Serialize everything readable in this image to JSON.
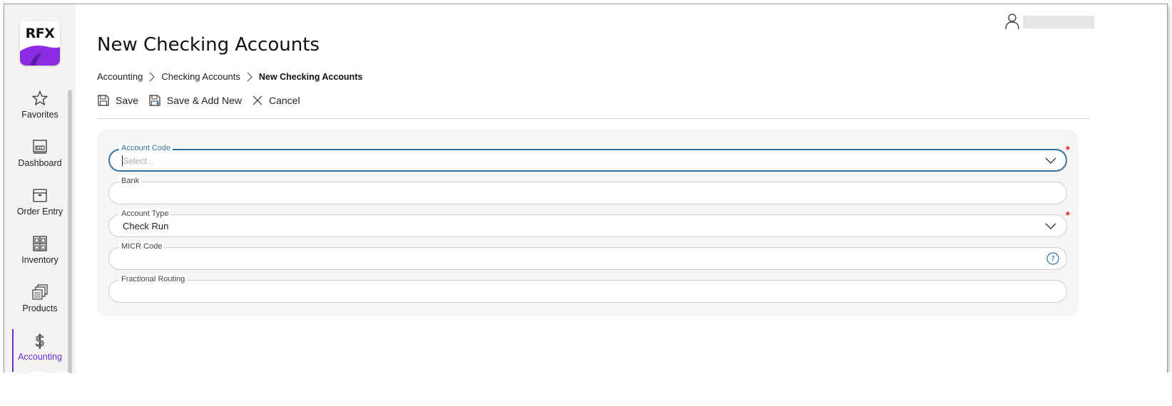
{
  "logo": {
    "text": "RFX",
    "brand_color": "#8b2be2"
  },
  "sidebar": {
    "items": [
      {
        "label": "Favorites",
        "icon": "star-icon"
      },
      {
        "label": "Dashboard",
        "icon": "dashboard-icon"
      },
      {
        "label": "Order Entry",
        "icon": "box-icon"
      },
      {
        "label": "Inventory",
        "icon": "shelves-icon"
      },
      {
        "label": "Products",
        "icon": "products-icon"
      },
      {
        "label": "Accounting",
        "icon": "dollar-icon",
        "active": true
      }
    ],
    "accent_color": "#6a2fd6"
  },
  "header": {
    "title": "New Checking Accounts",
    "breadcrumb": [
      "Accounting",
      "Checking Accounts",
      "New Checking Accounts"
    ]
  },
  "toolbar": {
    "save_label": "Save",
    "save_add_new_label": "Save & Add New",
    "cancel_label": "Cancel"
  },
  "form": {
    "account_code": {
      "label": "Account Code",
      "placeholder": "Select...",
      "value": "",
      "required": true
    },
    "bank": {
      "label": "Bank",
      "value": ""
    },
    "account_type": {
      "label": "Account Type",
      "value": "Check Run",
      "required": true
    },
    "micr_code": {
      "label": "MICR Code",
      "value": ""
    },
    "fractional_routing": {
      "label": "Fractional Routing",
      "value": ""
    }
  },
  "required_marker": "*"
}
